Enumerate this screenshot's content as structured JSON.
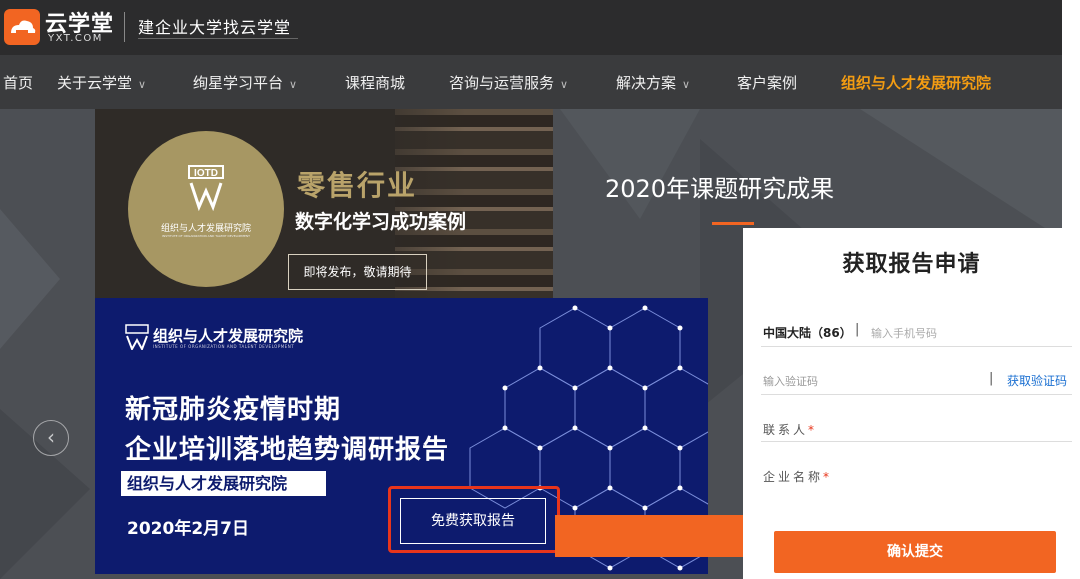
{
  "brand": {
    "logo_cn": "云学堂",
    "logo_en": "YXT.COM",
    "slogan": "建企业大学找云学堂"
  },
  "nav": {
    "items": [
      {
        "label": "首页",
        "dropdown": false
      },
      {
        "label": "关于云学堂",
        "dropdown": true
      },
      {
        "label": "绚星学习平台",
        "dropdown": true
      },
      {
        "label": "课程商城",
        "dropdown": false
      },
      {
        "label": "咨询与运营服务",
        "dropdown": true
      },
      {
        "label": "解决方案",
        "dropdown": true
      },
      {
        "label": "客户案例",
        "dropdown": false
      },
      {
        "label": "组织与人才发展研究院",
        "dropdown": false,
        "active": true
      }
    ],
    "chevron": "∨"
  },
  "hero": {
    "research_title": "2020年课题研究成果",
    "carousel_prev": "‹"
  },
  "retail_card": {
    "org_name": "组织与人才发展研究院",
    "org_en": "INSTITUTE OF ORGANIZATION AND TALENT DEVELOPMENT",
    "title_line1": "零售行业",
    "title_line2": "数字化学习成功案例",
    "button": "即将发布，敬请期待"
  },
  "covid_card": {
    "org_name": "组织与人才发展研究院",
    "org_en": "INSTITUTE OF ORGANIZATION AND TALENT DEVELOPMENT",
    "title_line1": "新冠肺炎疫情时期",
    "title_line2": "企业培训落地趋势调研报告",
    "tag": "组织与人才发展研究院",
    "date": "2020年2月7日",
    "button": "免费获取报告"
  },
  "form": {
    "title": "获取报告申请",
    "phone_prefix": "中国大陆（86）",
    "phone_separator": "|",
    "phone_placeholder": "输入手机号码",
    "code_placeholder": "输入验证码",
    "code_separator": "|",
    "code_button": "获取验证码",
    "contact_label": "联系人",
    "company_label": "企业名称",
    "required_mark": "*",
    "submit": "确认提交"
  },
  "colors": {
    "accent_orange": "#f26522",
    "nav_active": "#f39c12",
    "link_blue": "#1a6fd1",
    "highlight_red": "#e8351b",
    "covid_navy": "#0d1b6e",
    "gold": "#a79763"
  }
}
